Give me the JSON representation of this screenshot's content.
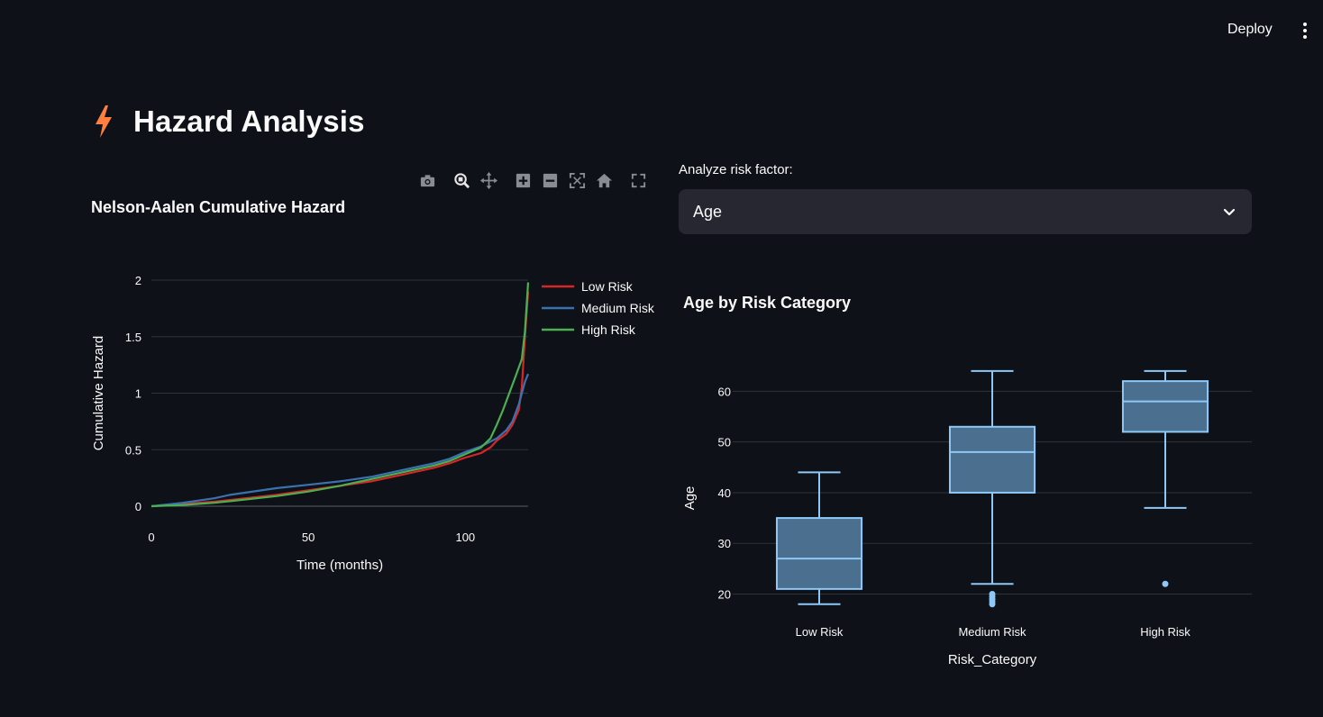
{
  "header": {
    "deploy_label": "Deploy",
    "menu_icon": "vertical-ellipsis-icon"
  },
  "page": {
    "title": "Hazard Analysis",
    "title_icon": "lightning-bolt-icon",
    "title_icon_color": "#ff7f3f"
  },
  "modebar": {
    "icons": [
      "camera-icon",
      "zoom-icon",
      "pan-icon",
      "zoom-in-icon",
      "zoom-out-icon",
      "autoscale-icon",
      "reset-axes-icon",
      "fullscreen-icon"
    ]
  },
  "selector": {
    "label": "Analyze risk factor:",
    "value": "Age"
  },
  "chart_data": [
    {
      "type": "line",
      "title": "Nelson-Aalen Cumulative Hazard",
      "xlabel": "Time (months)",
      "ylabel": "Cumulative Hazard",
      "xlim": [
        0,
        120
      ],
      "ylim": [
        0,
        2
      ],
      "xticks": [
        0,
        50,
        100
      ],
      "xtick_labels": [
        "0",
        "50",
        "100"
      ],
      "yticks": [
        0,
        0.5,
        1,
        1.5,
        2
      ],
      "ytick_labels": [
        "0",
        "0.5",
        "1",
        "1.5",
        "2"
      ],
      "grid": true,
      "legend_position": "top-right",
      "series": [
        {
          "name": "Low Risk",
          "color": "#d62728",
          "x": [
            0,
            10,
            20,
            30,
            40,
            50,
            60,
            70,
            80,
            90,
            95,
            100,
            105,
            108,
            110,
            113,
            115,
            117,
            118,
            119,
            120
          ],
          "y": [
            0,
            0.02,
            0.04,
            0.07,
            0.1,
            0.14,
            0.18,
            0.22,
            0.28,
            0.34,
            0.38,
            0.43,
            0.47,
            0.52,
            0.58,
            0.64,
            0.72,
            0.85,
            1.05,
            1.5,
            1.9
          ]
        },
        {
          "name": "Medium Risk",
          "color": "#3a72b0",
          "x": [
            0,
            10,
            20,
            25,
            30,
            40,
            50,
            60,
            70,
            80,
            90,
            95,
            100,
            105,
            110,
            113,
            115,
            117,
            119,
            120
          ],
          "y": [
            0,
            0.03,
            0.07,
            0.1,
            0.12,
            0.16,
            0.19,
            0.22,
            0.26,
            0.32,
            0.38,
            0.42,
            0.48,
            0.53,
            0.6,
            0.67,
            0.75,
            0.9,
            1.1,
            1.17
          ]
        },
        {
          "name": "High Risk",
          "color": "#4caf50",
          "x": [
            0,
            10,
            20,
            30,
            40,
            50,
            60,
            70,
            80,
            90,
            95,
            100,
            105,
            108,
            110,
            112,
            114,
            116,
            118,
            119,
            120
          ],
          "y": [
            0,
            0.01,
            0.03,
            0.06,
            0.09,
            0.13,
            0.18,
            0.24,
            0.3,
            0.36,
            0.4,
            0.46,
            0.52,
            0.6,
            0.72,
            0.85,
            1.0,
            1.15,
            1.3,
            1.55,
            1.98
          ]
        }
      ]
    },
    {
      "type": "box",
      "title": "Age by Risk Category",
      "xlabel": "Risk_Category",
      "ylabel": "Age",
      "ylim": [
        16,
        67
      ],
      "yticks": [
        20,
        30,
        40,
        50,
        60
      ],
      "ytick_labels": [
        "20",
        "30",
        "40",
        "50",
        "60"
      ],
      "grid": true,
      "color": "#8ec8f7",
      "fill": "#4a6f8f",
      "categories": [
        "Low Risk",
        "Medium Risk",
        "High Risk"
      ],
      "boxes": [
        {
          "min": 18,
          "q1": 21,
          "median": 27,
          "q3": 35,
          "max": 44,
          "outliers": []
        },
        {
          "min": 22,
          "q1": 40,
          "median": 48,
          "q3": 53,
          "max": 64,
          "outliers": [
            18,
            18.5,
            19,
            19.5,
            20
          ]
        },
        {
          "min": 37,
          "q1": 52,
          "median": 58,
          "q3": 62,
          "max": 64,
          "outliers": [
            22
          ]
        }
      ]
    }
  ]
}
